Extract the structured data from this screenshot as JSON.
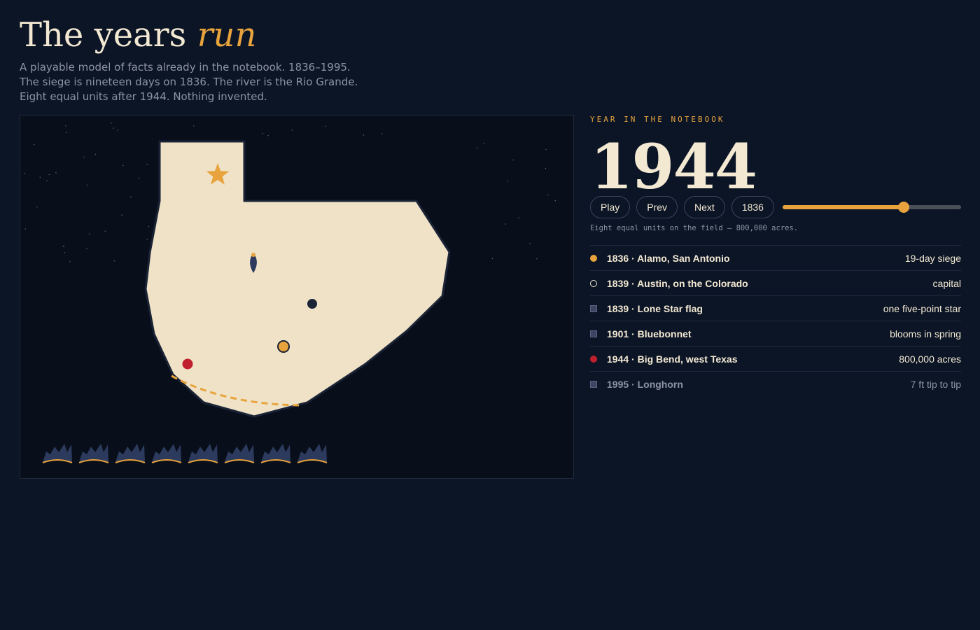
{
  "header": {
    "title_main": "The years",
    "title_em": "run",
    "intro_lines": [
      "A playable model of facts already in the notebook. 1836–1995.",
      "The siege is nineteen days on 1836. The river is the Rio Grande.",
      "Eight equal units after 1944. Nothing invented."
    ]
  },
  "side": {
    "eyebrow": "YEAR IN THE NOTEBOOK",
    "year": "1944",
    "controls": {
      "play_label": "Play",
      "prev_label": "Prev",
      "next_label": "Next",
      "reset_label": "1836"
    },
    "timeline": {
      "min": 1836,
      "max": 1995,
      "value": 1944
    },
    "note": "Eight equal units on the field — 800,000 acres.",
    "facts": [
      {
        "label": "1836 · Alamo, San Antonio",
        "value": "19-day siege",
        "marker": "dot-gold"
      },
      {
        "label": "1839 · Austin, on the Colorado",
        "value": "capital",
        "marker": "dot-ring"
      },
      {
        "label": "1839 · Lone Star flag",
        "value": "one five-point star",
        "marker": "sq"
      },
      {
        "label": "1901 · Bluebonnet",
        "value": "blooms in spring",
        "marker": "sq"
      },
      {
        "label": "1944 · Big Bend, west Texas",
        "value": "800,000 acres",
        "marker": "dot-red"
      },
      {
        "label": "1995 · Longhorn",
        "value": "7 ft tip to tip",
        "marker": "sq",
        "dim": true
      }
    ]
  },
  "map": {
    "unit_count": 8,
    "colors": {
      "land": "#efe2c6",
      "outline": "#1b2336",
      "accent": "#e8a33d",
      "red": "#c0202e",
      "navy": "#1b2336",
      "unit": "#2c3a5e",
      "background": "#080e1a"
    },
    "icons": {
      "capital": "star-icon",
      "flag": "flame-icon",
      "unit": "park-unit-icon"
    }
  }
}
